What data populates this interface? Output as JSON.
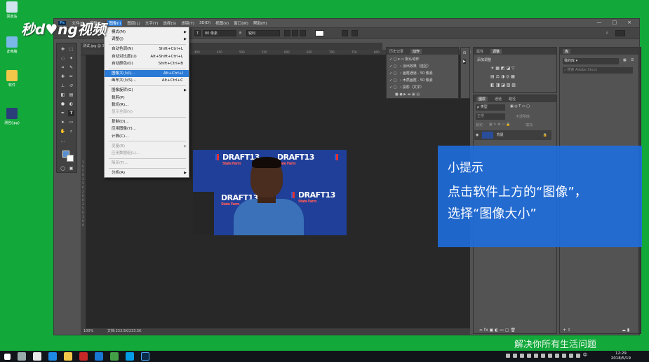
{
  "desktop": {
    "icons": [
      {
        "label": "回收站"
      },
      {
        "label": "此电脑"
      },
      {
        "label": "软件"
      },
      {
        "label": "测名(jpg)"
      }
    ]
  },
  "watermark": {
    "logo": "秒d♥ng视频",
    "slogan": "解决你所有生活问题"
  },
  "photoshop": {
    "app_logo": "Ps",
    "menubar": [
      "文件(F)",
      "编辑(E)",
      "图像(I)",
      "图层(L)",
      "文字(Y)",
      "选择(S)",
      "滤镜(T)",
      "3D(D)",
      "视图(V)",
      "窗口(W)",
      "帮助(H)"
    ],
    "window_controls": [
      "—",
      "□",
      "×"
    ],
    "options": {
      "font_size": "80 像素",
      "antialias": "锐利"
    },
    "doc_tab": "测试.jpg @ 33...",
    "ruler_h": [
      "200",
      "250",
      "300",
      "350",
      "400",
      "450",
      "500",
      "550",
      "600",
      "650",
      "700",
      "750",
      "800",
      "850",
      "900",
      "950",
      "1000"
    ],
    "ruler_v": [
      "1",
      "0",
      "5",
      "0",
      "1",
      "5",
      "0",
      "2",
      "0",
      "0",
      "2",
      "5",
      "0",
      "3",
      "0",
      "0"
    ],
    "status": {
      "zoom": "100%",
      "doc": "文档:233.5K/233.5K"
    },
    "image_menu": {
      "items": [
        {
          "label": "模式(M)",
          "shortcut": "",
          "arrow": "▶",
          "disabled": false
        },
        {
          "label": "调整(J)",
          "shortcut": "",
          "arrow": "▶",
          "disabled": false
        },
        {
          "label": "自动色调(N)",
          "shortcut": "Shift+Ctrl+L",
          "arrow": "",
          "disabled": false
        },
        {
          "label": "自动对比度(U)",
          "shortcut": "Alt+Shift+Ctrl+L",
          "arrow": "",
          "disabled": false
        },
        {
          "label": "自动颜色(O)",
          "shortcut": "Shift+Ctrl+B",
          "arrow": "",
          "disabled": false
        },
        {
          "label": "图像大小(I)...",
          "shortcut": "Alt+Ctrl+I",
          "arrow": "",
          "disabled": false,
          "selected": true
        },
        {
          "label": "画布大小(S)...",
          "shortcut": "Alt+Ctrl+C",
          "arrow": "",
          "disabled": false
        },
        {
          "label": "图像旋转(G)",
          "shortcut": "",
          "arrow": "▶",
          "disabled": false
        },
        {
          "label": "裁剪(P)",
          "shortcut": "",
          "arrow": "",
          "disabled": false
        },
        {
          "label": "裁切(R)...",
          "shortcut": "",
          "arrow": "",
          "disabled": false
        },
        {
          "label": "显示全部(V)",
          "shortcut": "",
          "arrow": "",
          "disabled": true
        },
        {
          "label": "复制(D)...",
          "shortcut": "",
          "arrow": "",
          "disabled": false
        },
        {
          "label": "应用图像(Y)...",
          "shortcut": "",
          "arrow": "",
          "disabled": false
        },
        {
          "label": "计算(C)...",
          "shortcut": "",
          "arrow": "",
          "disabled": false
        },
        {
          "label": "变量(B)",
          "shortcut": "",
          "arrow": "▶",
          "disabled": true
        },
        {
          "label": "应用数据组(L)...",
          "shortcut": "",
          "arrow": "",
          "disabled": true
        },
        {
          "label": "陷印(T)...",
          "shortcut": "",
          "arrow": "",
          "disabled": true
        },
        {
          "label": "分析(A)",
          "shortcut": "",
          "arrow": "▶",
          "disabled": false
        }
      ]
    },
    "history_panel": {
      "tabs": [
        "历史记录",
        "动作"
      ],
      "rows": [
        "默认动作",
        "淡出效果（选区）",
        "画框通道 - 50 像素",
        "木质画框 - 50 像素",
        "投影（文字）"
      ]
    },
    "properties_panel": {
      "tabs": [
        "属性",
        "调整"
      ],
      "title": "添加调整"
    },
    "library_panel": {
      "tab": "库",
      "dropdown": "我的库",
      "search": "搜索 Adobe Stock"
    },
    "layers_panel": {
      "tabs": [
        "图层",
        "通道",
        "路径"
      ],
      "filter": "ρ 类型",
      "blend": "正常",
      "opacity_label": "不透明度:",
      "lock_label": "锁定:",
      "fill_label": "填充:",
      "layer_name": "背景"
    },
    "photo": {
      "banner_text": "DRAFT13",
      "banner_sub": "State Farm"
    }
  },
  "tip": {
    "title": "小提示",
    "line1": "点击软件上方的“图像”，",
    "line2": "选择“图像大小”"
  },
  "taskbar": {
    "time": "12:29",
    "date": "2018/5/19",
    "ime": "中"
  }
}
